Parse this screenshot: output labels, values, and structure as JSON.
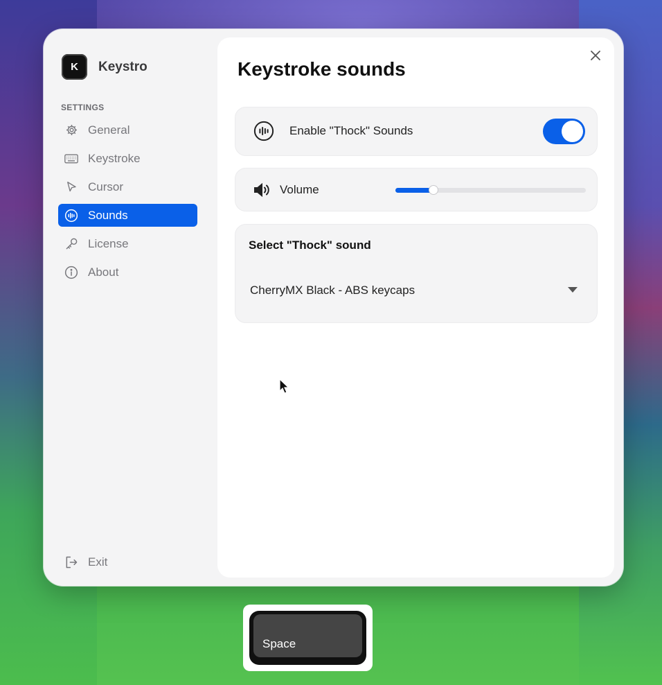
{
  "app": {
    "name": "Keystro",
    "logo_letter": "K"
  },
  "sidebar": {
    "section_label": "SETTINGS",
    "items": [
      {
        "label": "General",
        "icon": "gear-icon",
        "active": false
      },
      {
        "label": "Keystroke",
        "icon": "keyboard-icon",
        "active": false
      },
      {
        "label": "Cursor",
        "icon": "cursor-icon",
        "active": false
      },
      {
        "label": "Sounds",
        "icon": "sound-wave-icon",
        "active": true
      },
      {
        "label": "License",
        "icon": "key-icon",
        "active": false
      },
      {
        "label": "About",
        "icon": "info-icon",
        "active": false
      }
    ],
    "exit_label": "Exit"
  },
  "main": {
    "title": "Keystroke sounds",
    "enable_label": "Enable \"Thock\" Sounds",
    "enable_on": true,
    "volume_label": "Volume",
    "volume_fraction": 0.2,
    "select_title": "Select \"Thock\" sound",
    "select_value": "CherryMX Black - ABS keycaps"
  },
  "key_overlay": {
    "label": "Space"
  },
  "colors": {
    "accent": "#0a60e8",
    "sidebar_bg": "#f4f4f5",
    "text_muted": "#77777c"
  }
}
